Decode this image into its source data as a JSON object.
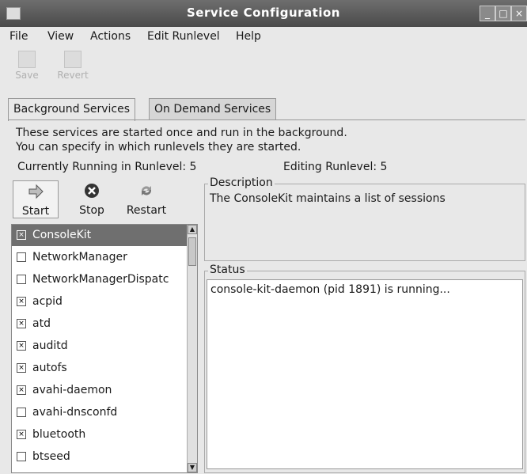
{
  "window": {
    "title": "Service Configuration",
    "min": "_",
    "max": "□",
    "close": "×"
  },
  "menu": {
    "file": "File",
    "view": "View",
    "actions": "Actions",
    "edit_runlevel": "Edit Runlevel",
    "help": "Help"
  },
  "toolbar": {
    "save": "Save",
    "revert": "Revert"
  },
  "tabs": {
    "background": "Background Services",
    "on_demand": "On Demand Services"
  },
  "info": {
    "line1": "These services are started once and run in the background.",
    "line2": "You can specify in which runlevels they are started.",
    "running": "Currently Running in Runlevel: 5",
    "editing": "Editing Runlevel: 5"
  },
  "actions": {
    "start": "Start",
    "stop": "Stop",
    "restart": "Restart"
  },
  "services": [
    {
      "name": "ConsoleKit",
      "checked": true
    },
    {
      "name": "NetworkManager",
      "checked": false
    },
    {
      "name": "NetworkManagerDispatc",
      "checked": false
    },
    {
      "name": "acpid",
      "checked": true
    },
    {
      "name": "atd",
      "checked": true
    },
    {
      "name": "auditd",
      "checked": true
    },
    {
      "name": "autofs",
      "checked": true
    },
    {
      "name": "avahi-daemon",
      "checked": true
    },
    {
      "name": "avahi-dnsconfd",
      "checked": false
    },
    {
      "name": "bluetooth",
      "checked": true
    },
    {
      "name": "btseed",
      "checked": false
    }
  ],
  "check_mark": "×",
  "description": {
    "label": "Description",
    "text": "The ConsoleKit maintains a list of sessions"
  },
  "status": {
    "label": "Status",
    "text": "console-kit-daemon (pid 1891) is running..."
  }
}
